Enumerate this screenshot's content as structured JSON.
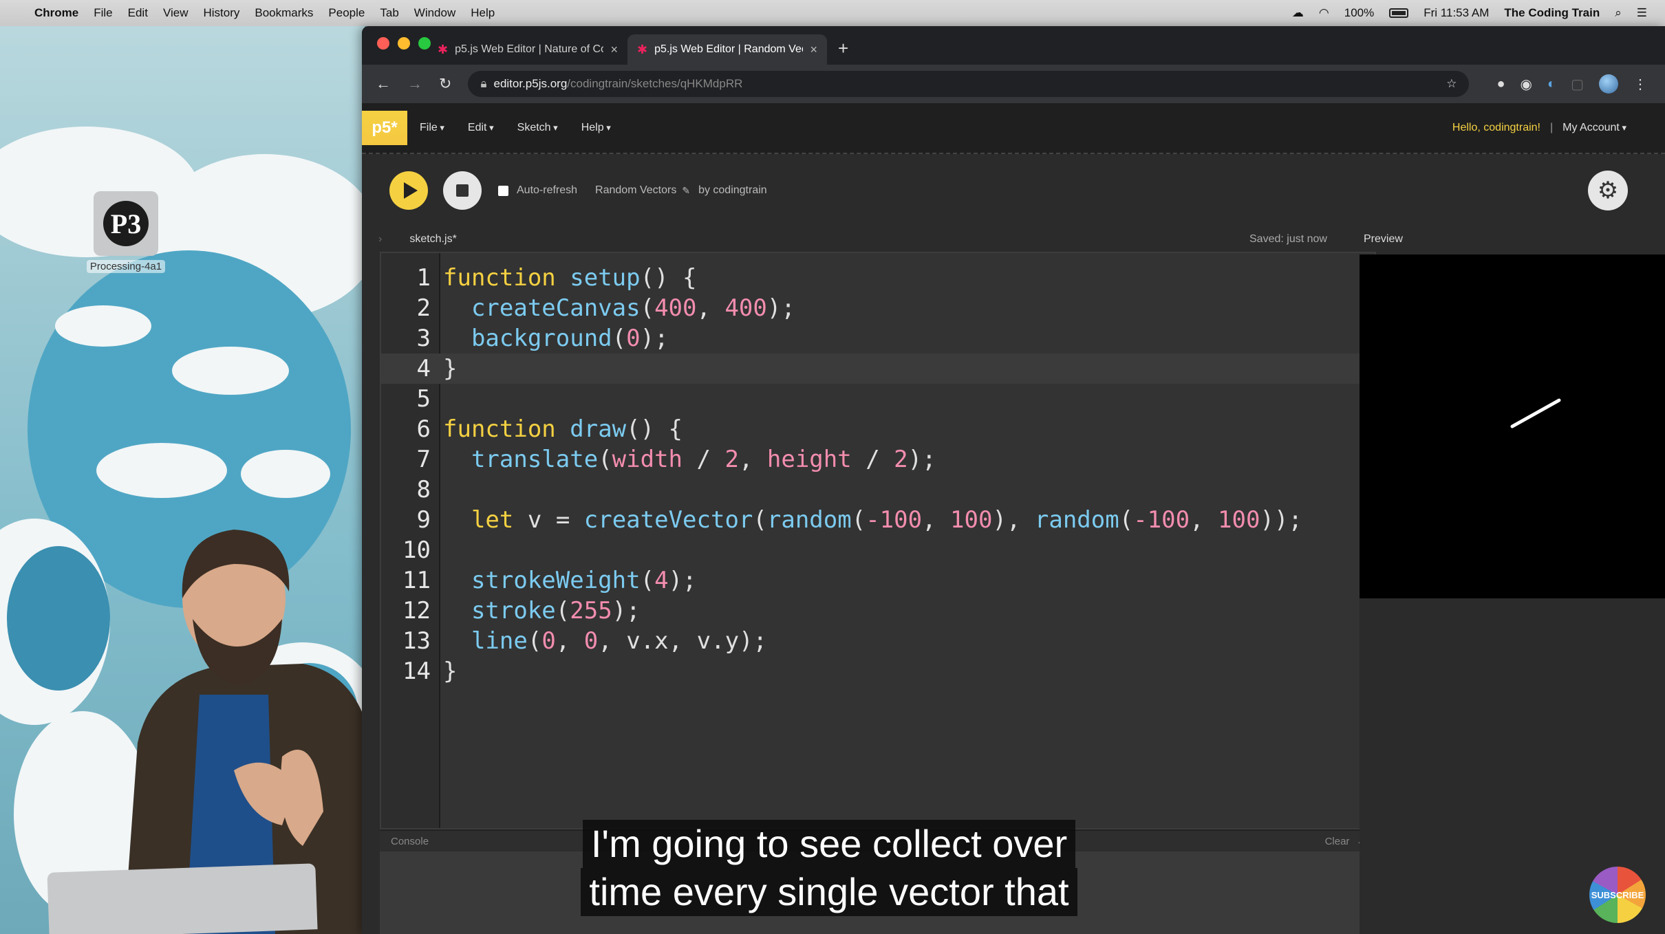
{
  "menubar": {
    "app_name": "Chrome",
    "items": [
      "File",
      "Edit",
      "View",
      "History",
      "Bookmarks",
      "People",
      "Tab",
      "Window",
      "Help"
    ],
    "battery": "100%",
    "clock": "Fri 11:53 AM",
    "user": "The Coding Train"
  },
  "desktop": {
    "icon_label": "Processing-4a1",
    "icon_glyph": "P3"
  },
  "browser": {
    "tabs": [
      {
        "title": "p5.js Web Editor | Nature of Co..."
      },
      {
        "title": "p5.js Web Editor | Random Vec..."
      }
    ],
    "url_host": "editor.p5js.org",
    "url_path": "/codingtrain/sketches/qHKMdpRR"
  },
  "p5": {
    "logo": "p5*",
    "menus": [
      "File",
      "Edit",
      "Sketch",
      "Help"
    ],
    "hello": "Hello, codingtrain!",
    "account": "My Account",
    "auto_refresh": "Auto-refresh",
    "sketch_name": "Random Vectors",
    "byline": "by codingtrain",
    "file_name": "sketch.js*",
    "saved": "Saved: just now",
    "preview_label": "Preview",
    "console_label": "Console",
    "console_clear": "Clear"
  },
  "code": {
    "line_numbers": [
      "1",
      "2",
      "3",
      "4",
      "5",
      "6",
      "7",
      "8",
      "9",
      "10",
      "11",
      "12",
      "13",
      "14"
    ],
    "lines": [
      "function setup() {",
      "  createCanvas(400, 400);",
      "  background(0);",
      "}",
      "",
      "function draw() {",
      "  translate(width / 2, height / 2);",
      "",
      "  let v = createVector(random(-100, 100), random(-100, 100));",
      "",
      "  strokeWeight(4);",
      "  stroke(255);",
      "  line(0, 0, v.x, v.y);",
      "}"
    ]
  },
  "subtitle": {
    "line1": "I'm going to see collect over",
    "line2": "time every single vector that"
  },
  "subscribe_label": "SUBSCRIBE"
}
